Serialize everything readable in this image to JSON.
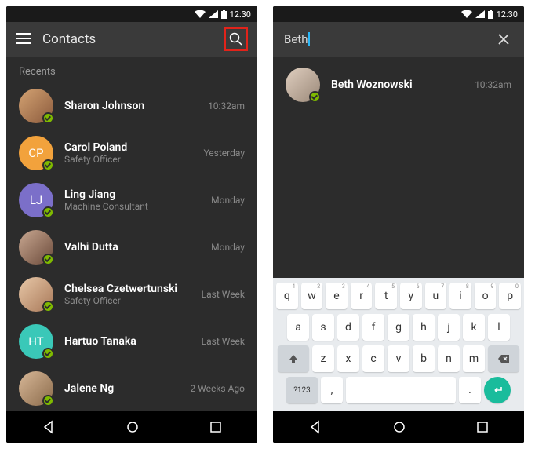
{
  "status": {
    "time": "12:30"
  },
  "left": {
    "title": "Contacts",
    "section": "Recents",
    "contacts": [
      {
        "name": "Sharon Johnson",
        "sub": "",
        "time": "10:32am",
        "initials": "",
        "avatarClass": "av-photo1"
      },
      {
        "name": "Carol Poland",
        "sub": "Safety Officer",
        "time": "Yesterday",
        "initials": "CP",
        "avatarClass": "av-orange"
      },
      {
        "name": "Ling Jiang",
        "sub": "Machine Consultant",
        "time": "Monday",
        "initials": "LJ",
        "avatarClass": "av-purple"
      },
      {
        "name": "Valhi Dutta",
        "sub": "",
        "time": "Monday",
        "initials": "",
        "avatarClass": "av-photo2"
      },
      {
        "name": "Chelsea Czetwertunski",
        "sub": "Safety Officer",
        "time": "Last Week",
        "initials": "",
        "avatarClass": "av-photo3"
      },
      {
        "name": "Hartuo Tanaka",
        "sub": "",
        "time": "Last Week",
        "initials": "HT",
        "avatarClass": "av-teal"
      },
      {
        "name": "Jalene Ng",
        "sub": "",
        "time": "2 Weeks Ago",
        "initials": "",
        "avatarClass": "av-photo4"
      }
    ]
  },
  "right": {
    "query": "Beth",
    "result": {
      "name": "Beth Woznowski",
      "time": "10:32am"
    },
    "keyboard": {
      "row1": [
        "q",
        "w",
        "e",
        "r",
        "t",
        "y",
        "u",
        "i",
        "o",
        "p"
      ],
      "nums": [
        "1",
        "2",
        "3",
        "4",
        "5",
        "6",
        "7",
        "8",
        "9",
        "0"
      ],
      "row2": [
        "a",
        "s",
        "d",
        "f",
        "g",
        "h",
        "j",
        "k",
        "l"
      ],
      "row3": [
        "z",
        "x",
        "c",
        "v",
        "b",
        "n",
        "m"
      ],
      "symKey": "?123",
      "comma": ",",
      "period": "."
    }
  }
}
